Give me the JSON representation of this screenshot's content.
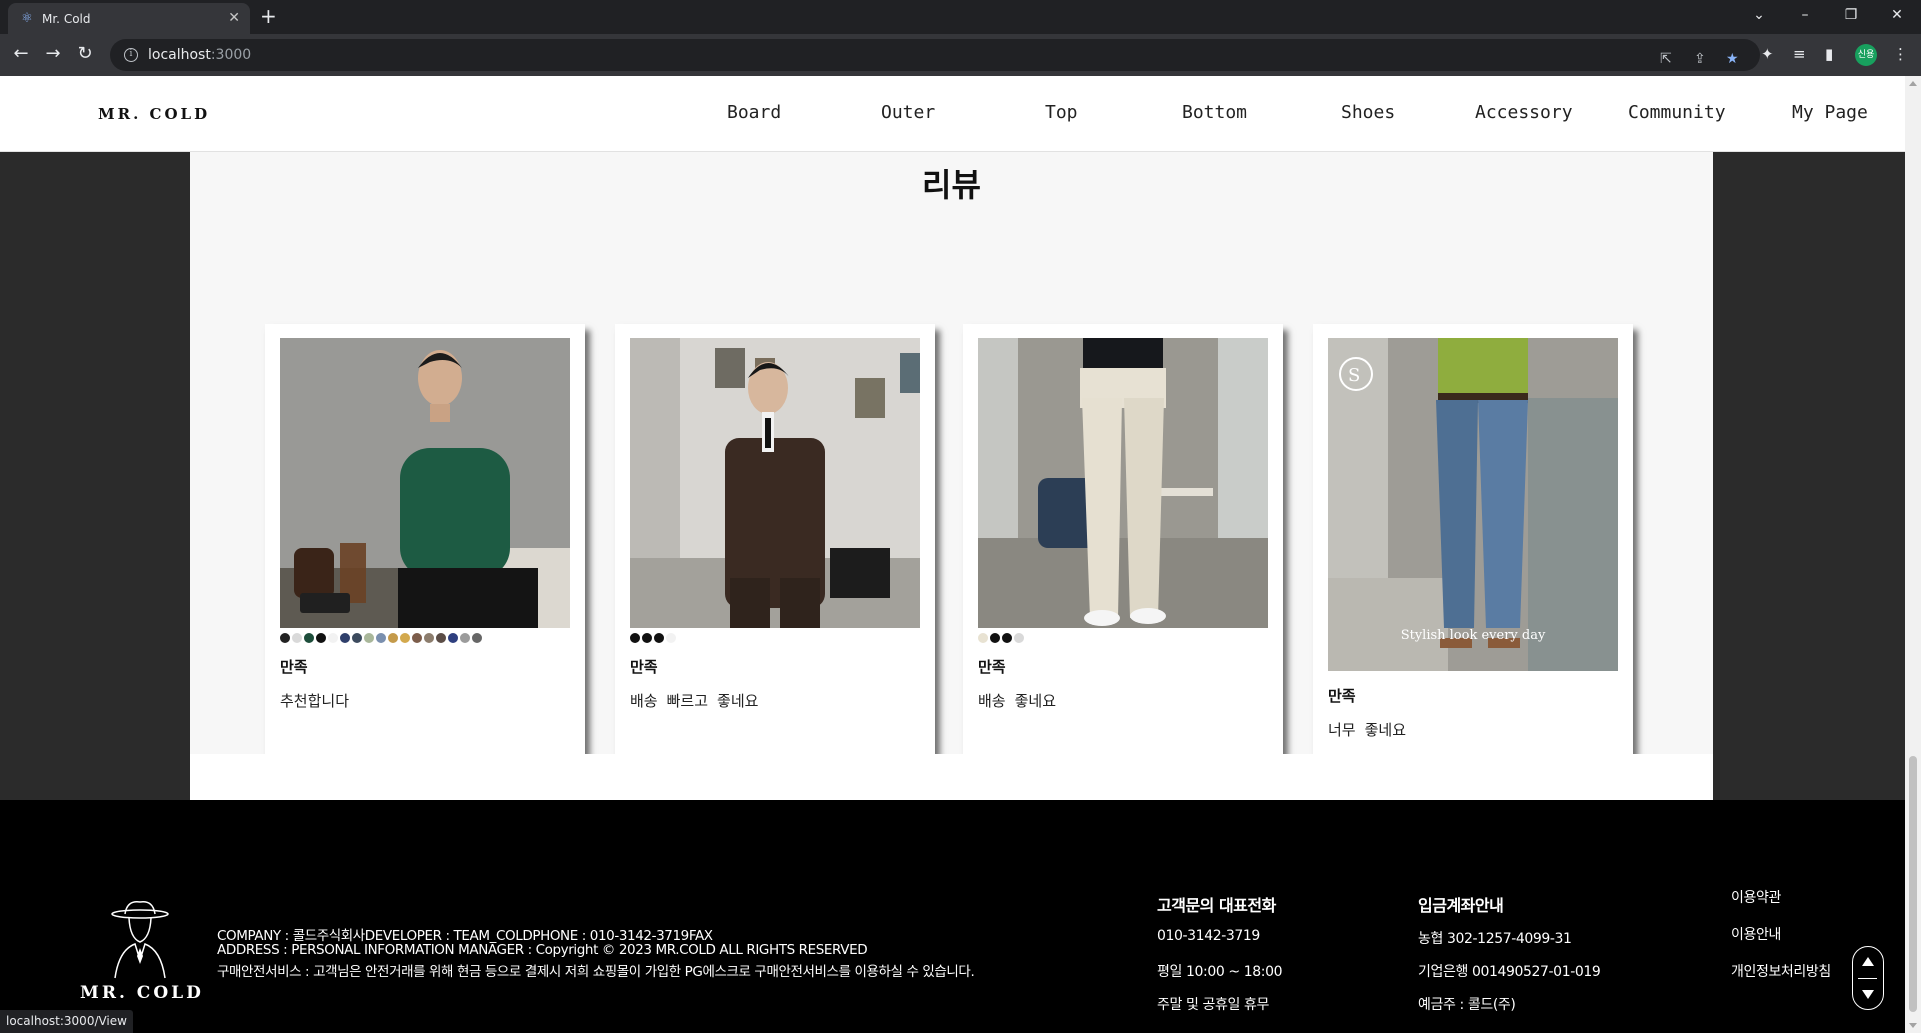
{
  "browser": {
    "tab_title": "Mr. Cold",
    "favicon_icon": "react-icon",
    "url_host": "localhost",
    "url_port": ":3000",
    "profile_initials": "신용",
    "status_url": "localhost:3000/View"
  },
  "header": {
    "logo": "MR. COLD",
    "nav": [
      "Board",
      "Outer",
      "Top",
      "Bottom",
      "Shoes",
      "Accessory",
      "Community",
      "My Page"
    ]
  },
  "reviews": {
    "title": "리뷰",
    "cards": [
      {
        "rating": "만족",
        "comment": "추천합니다",
        "swatches": [
          "#222222",
          "#d9d9d9",
          "#1d4d3a",
          "#111111",
          "#f2f2f2",
          "#2f3f6b",
          "#3c4b5e",
          "#a9b79a",
          "#7a8fae",
          "#c49a4b",
          "#d3a94d",
          "#7c5d4b",
          "#8c7d6d",
          "#5b4d46",
          "#2e3f7f",
          "#9b9b9b",
          "#666666"
        ]
      },
      {
        "rating": "만족",
        "comment": "배송 빠르고 좋네요",
        "swatches": [
          "#111111",
          "#111111",
          "#111111",
          "#f2f2f2"
        ]
      },
      {
        "rating": "만족",
        "comment": "배송 좋네요",
        "swatches": [
          "#e8e2d2",
          "#111111",
          "#111111",
          "#d9d9d9"
        ]
      },
      {
        "rating": "만족",
        "comment": "너무 좋네요",
        "photo_caption": "Stylish look every day",
        "swatches": []
      }
    ]
  },
  "footer": {
    "logo": "MR. COLD",
    "info_lines": [
      "COMPANY : 콜드주식회사DEVELOPER : TEAM_COLDPHONE : 010-3142-3719FAX",
      "ADDRESS : PERSONAL INFORMATION MANAGER : Copyright © 2023 MR.COLD ALL RIGHTS RESERVED",
      "구매안전서비스 : 고객님은 안전거래를 위해 현금 등으로 결제시 저희 쇼핑몰이 가입한 PG에스크로 구매안전서비스를 이용하실 수 있습니다."
    ],
    "phone": {
      "title": "고객문의 대표전화",
      "number": "010-3142-3719",
      "hours": "평일 10:00 ~ 18:00",
      "closed": "주말 및 공휴일 휴무"
    },
    "bank": {
      "title": "입금계좌안내",
      "account1": "농협 302-1257-4099-31",
      "account2": "기업은행 001490527-01-019",
      "holder": "예금주 : 콜드(주)"
    },
    "links": [
      "이용약관",
      "이용안내",
      "개인정보처리방침"
    ]
  }
}
